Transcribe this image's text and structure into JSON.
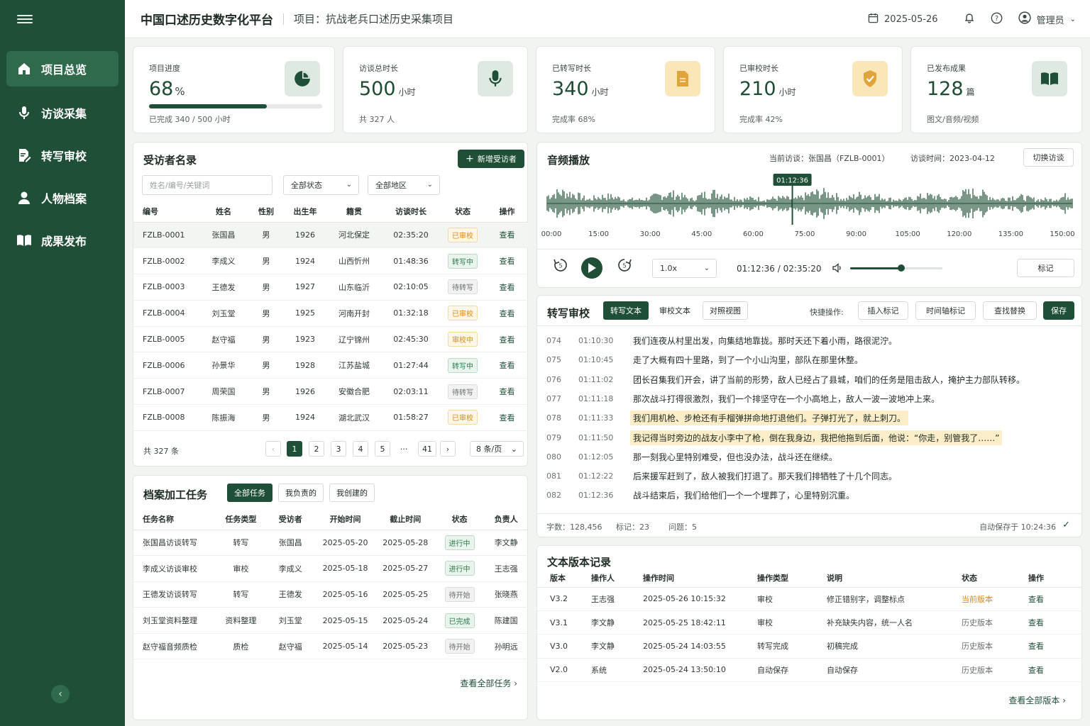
{
  "sidebar": {
    "items": [
      {
        "label": "项目总览"
      },
      {
        "label": "访谈采集"
      },
      {
        "label": "转写审校"
      },
      {
        "label": "人物档案"
      },
      {
        "label": "成果发布"
      }
    ]
  },
  "header": {
    "title": "中国口述历史数字化平台",
    "project": "项目：抗战老兵口述历史采集项目",
    "date": "2025-05-26",
    "user": "管理员"
  },
  "stats": [
    {
      "label": "项目进度",
      "value": "68",
      "unit": "%",
      "sub": "已完成 340 / 500 小时",
      "progress": 0.68
    },
    {
      "label": "访谈总时长",
      "value": "500",
      "unit": "小时",
      "sub": "共 327 人"
    },
    {
      "label": "已转写时长",
      "value": "340",
      "unit": "小时",
      "sub": "完成率  68%"
    },
    {
      "label": "已审校时长",
      "value": "210",
      "unit": "小时",
      "sub": "完成率  42%"
    },
    {
      "label": "已发布成果",
      "value": "128",
      "unit": "篇",
      "sub": "图文/音频/视频"
    }
  ],
  "interviewees": {
    "title": "受访者名录",
    "add_label": "新增受访者",
    "search_placeholder": "姓名/编号/关键词",
    "status_filter": "全部状态",
    "region_filter": "全部地区",
    "columns": [
      "编号",
      "姓名",
      "性别",
      "出生年",
      "籍贯",
      "访谈时长",
      "状态",
      "操作"
    ],
    "rows": [
      {
        "id": "FZLB-0001",
        "name": "张国昌",
        "sex": "男",
        "born": "1926",
        "origin": "河北保定",
        "dur": "02:35:20",
        "status": "已审校",
        "cls": "b-orange",
        "op": "查看"
      },
      {
        "id": "FZLB-0002",
        "name": "李成义",
        "sex": "男",
        "born": "1924",
        "origin": "山西忻州",
        "dur": "01:48:36",
        "status": "转写中",
        "cls": "b-green",
        "op": "查看"
      },
      {
        "id": "FZLB-0003",
        "name": "王德发",
        "sex": "男",
        "born": "1927",
        "origin": "山东临沂",
        "dur": "02:10:05",
        "status": "待转写",
        "cls": "b-gray",
        "op": "查看"
      },
      {
        "id": "FZLB-0004",
        "name": "刘玉堂",
        "sex": "男",
        "born": "1925",
        "origin": "河南开封",
        "dur": "01:32:18",
        "status": "已审校",
        "cls": "b-orange",
        "op": "查看"
      },
      {
        "id": "FZLB-0005",
        "name": "赵守福",
        "sex": "男",
        "born": "1923",
        "origin": "辽宁锦州",
        "dur": "02:45:30",
        "status": "审校中",
        "cls": "b-orange",
        "op": "查看"
      },
      {
        "id": "FZLB-0006",
        "name": "孙景华",
        "sex": "男",
        "born": "1928",
        "origin": "江苏盐城",
        "dur": "01:27:44",
        "status": "转写中",
        "cls": "b-green",
        "op": "查看"
      },
      {
        "id": "FZLB-0007",
        "name": "周荣国",
        "sex": "男",
        "born": "1926",
        "origin": "安徽合肥",
        "dur": "02:03:11",
        "status": "待转写",
        "cls": "b-gray",
        "op": "查看"
      },
      {
        "id": "FZLB-0008",
        "name": "陈振海",
        "sex": "男",
        "born": "1924",
        "origin": "湖北武汉",
        "dur": "01:58:27",
        "status": "已审校",
        "cls": "b-orange",
        "op": "查看"
      }
    ],
    "total": "共 327 条",
    "pages": [
      "1",
      "2",
      "3",
      "4",
      "5",
      "···",
      "41"
    ],
    "page_size": "8 条/页"
  },
  "tasks": {
    "title": "档案加工任务",
    "tabs": [
      "全部任务",
      "我负责的",
      "我创建的"
    ],
    "columns": [
      "任务名称",
      "任务类型",
      "受访者",
      "开始时间",
      "截止时间",
      "状态",
      "负责人"
    ],
    "rows": [
      {
        "name": "张国昌访谈转写",
        "type": "转写",
        "who": "张国昌",
        "start": "2025-05-20",
        "end": "2025-05-28",
        "status": "进行中",
        "cls": "b-green",
        "owner": "李文静"
      },
      {
        "name": "李成义访谈审校",
        "type": "审校",
        "who": "李成义",
        "start": "2025-05-18",
        "end": "2025-05-27",
        "status": "进行中",
        "cls": "b-green",
        "owner": "王志强"
      },
      {
        "name": "王德发访谈转写",
        "type": "转写",
        "who": "王德发",
        "start": "2025-05-16",
        "end": "2025-05-25",
        "status": "待开始",
        "cls": "b-gray",
        "owner": "张晓燕"
      },
      {
        "name": "刘玉堂资料整理",
        "type": "资料整理",
        "who": "刘玉堂",
        "start": "2025-05-15",
        "end": "2025-05-24",
        "status": "已完成",
        "cls": "b-green",
        "owner": "陈建国"
      },
      {
        "name": "赵守福音频质检",
        "type": "质检",
        "who": "赵守福",
        "start": "2025-05-14",
        "end": "2025-05-23",
        "status": "待开始",
        "cls": "b-gray",
        "owner": "孙明远"
      }
    ],
    "more": "查看全部任务"
  },
  "audio": {
    "title": "音频播放",
    "current": "当前访谈：张国昌（FZLB-0001）",
    "time": "访谈时间：2023-04-12",
    "switch": "切换访谈",
    "playhead": "01:12:36",
    "ticks": [
      "00:00",
      "15:00",
      "30:00",
      "45:00",
      "60:00",
      "75:00",
      "90:00",
      "105:00",
      "120:00",
      "135:00",
      "150:00"
    ],
    "speed": "1.0x",
    "position": "01:12:36 / 02:35:20",
    "mark": "标记",
    "playhead_fraction": 0.467,
    "volume": 0.55
  },
  "transcript": {
    "title": "转写审校",
    "tabs": [
      "转写文本",
      "审校文本",
      "对照视图"
    ],
    "quick": "快捷操作:",
    "actions": [
      "插入标记",
      "时间轴标记",
      "查找替换"
    ],
    "save": "保存",
    "lines": [
      {
        "n": "074",
        "t": "01:10:30",
        "text": "我们连夜从村里出发，向集结地靠拢。那时天还下着小雨，路很泥泞。",
        "hl": false
      },
      {
        "n": "075",
        "t": "01:10:45",
        "text": "走了大概有四十里路，到了一个小山沟里，部队在那里休整。",
        "hl": false
      },
      {
        "n": "076",
        "t": "01:11:02",
        "text": "团长召集我们开会，讲了当前的形势，敌人已经占了县城，咱们的任务是阻击敌人，掩护主力部队转移。",
        "hl": false
      },
      {
        "n": "077",
        "t": "01:11:18",
        "text": "那次战斗打得很激烈，我们一个排坚守在一个小高地上，敌人一波一波地冲上来。",
        "hl": false
      },
      {
        "n": "078",
        "t": "01:11:33",
        "text": "我们用机枪、步枪还有手榴弹拼命地打退他们。子弹打光了，就上刺刀。",
        "hl": true
      },
      {
        "n": "079",
        "t": "01:11:50",
        "text": "我记得当时旁边的战友小李中了枪，倒在我身边，我把他拖到后面，他说：“你走，别管我了……”",
        "hl": true
      },
      {
        "n": "080",
        "t": "01:12:05",
        "text": "那一刻我心里特别难受，但也没办法，战斗还在继续。",
        "hl": false
      },
      {
        "n": "081",
        "t": "01:12:22",
        "text": "后来援军赶到了，敌人被我们打退了。那天我们排牺牲了十几个同志。",
        "hl": false
      },
      {
        "n": "082",
        "t": "01:12:36",
        "text": "战斗结束后，我们给他们一个一个埋葬了，心里特别沉重。",
        "hl": false
      }
    ],
    "words": "字数：128,456",
    "marks": "标记：23",
    "issues": "问题：5",
    "autosave": "自动保存于 10:24:36"
  },
  "versions": {
    "title": "文本版本记录",
    "columns": [
      "版本",
      "操作人",
      "操作时间",
      "操作类型",
      "说明",
      "状态",
      "操作"
    ],
    "rows": [
      {
        "v": "V3.2",
        "who": "王志强",
        "time": "2025-05-26 10:15:32",
        "type": "审校",
        "note": "修正错别字，调整标点",
        "status": "当前版本",
        "cur": true,
        "op": "查看"
      },
      {
        "v": "V3.1",
        "who": "李文静",
        "time": "2025-05-25 18:42:11",
        "type": "审校",
        "note": "补充缺失内容，统一人名",
        "status": "历史版本",
        "cur": false,
        "op": "查看"
      },
      {
        "v": "V3.0",
        "who": "李文静",
        "time": "2025-05-24 14:03:55",
        "type": "转写完成",
        "note": "初稿完成",
        "status": "历史版本",
        "cur": false,
        "op": "查看"
      },
      {
        "v": "V2.0",
        "who": "系统",
        "time": "2025-05-24 13:50:10",
        "type": "自动保存",
        "note": "自动保存",
        "status": "历史版本",
        "cur": false,
        "op": "查看"
      }
    ],
    "more": "查看全部版本"
  },
  "colors": {
    "brand": "#1f4f36",
    "accent_orange": "#d88a19",
    "highlight": "#fbeec8"
  }
}
